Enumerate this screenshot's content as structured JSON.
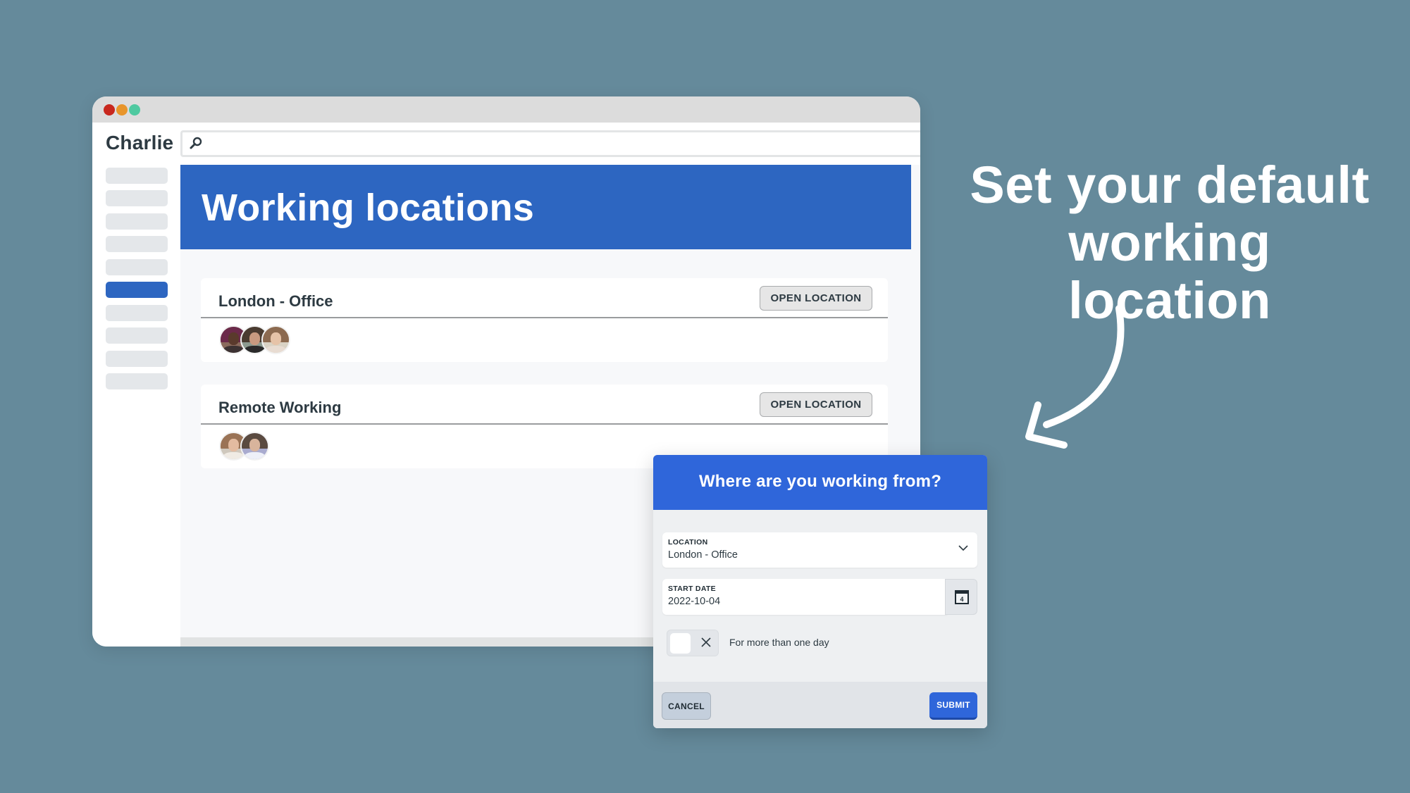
{
  "app": {
    "brand": "Charlie",
    "search": {
      "placeholder": "",
      "value": ""
    },
    "sidebar": {
      "item_count": 10,
      "active_index": 5
    }
  },
  "main": {
    "title": "Working locations",
    "locations": [
      {
        "name": "London - Office",
        "button_label": "OPEN LOCATION",
        "avatar_count": 3
      },
      {
        "name": "Remote Working",
        "button_label": "OPEN LOCATION",
        "avatar_count": 2
      }
    ]
  },
  "headline": {
    "line1": "Set your default",
    "line2": "working location"
  },
  "modal": {
    "title": "Where are you working from?",
    "location_field": {
      "label": "LOCATION",
      "value": "London - Office"
    },
    "start_date_field": {
      "label": "START DATE",
      "value": "2022-10-04"
    },
    "calendar_day": "4",
    "multi_day_toggle": {
      "label": "For more than one day",
      "checked": false
    },
    "cancel_label": "CANCEL",
    "submit_label": "SUBMIT"
  },
  "colors": {
    "background": "#658a9b",
    "brand_blue": "#2d66c1",
    "modal_blue": "#2f66da",
    "text_dark": "#2d3a42"
  }
}
